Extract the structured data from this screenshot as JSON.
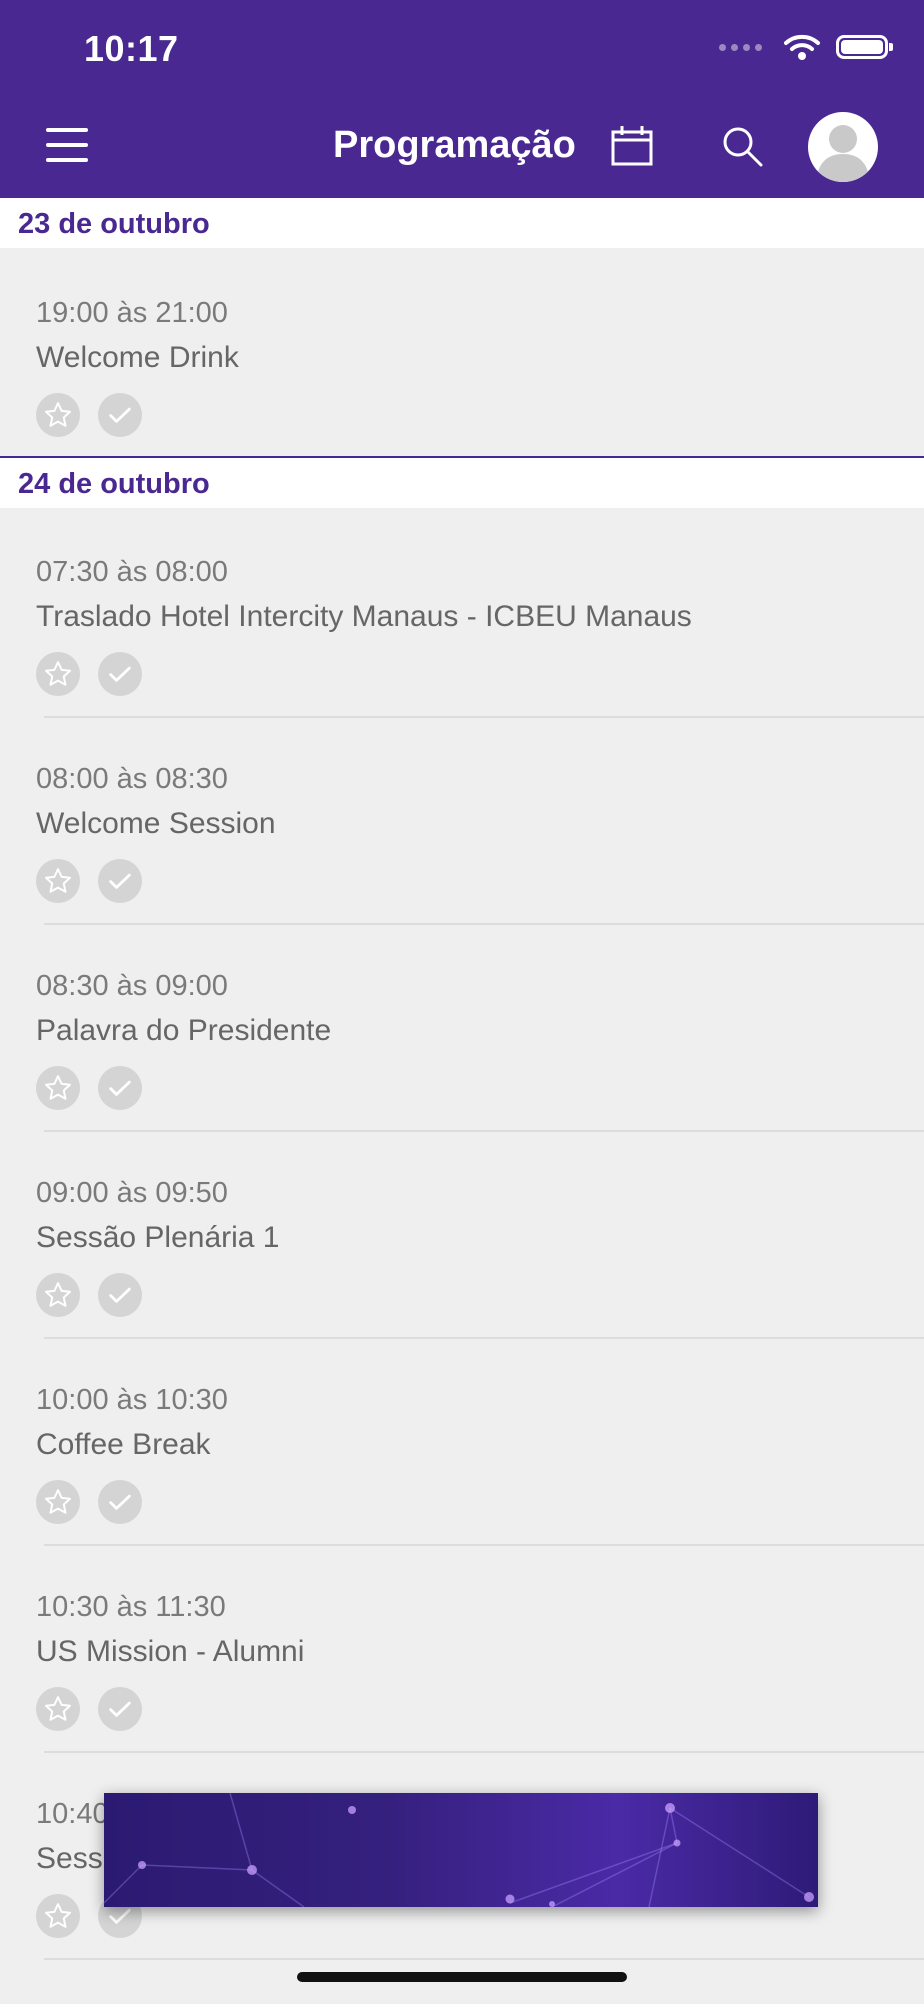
{
  "status_bar": {
    "time": "10:17"
  },
  "header": {
    "title": "Programação",
    "menu_icon": "hamburger-menu-icon",
    "calendar_icon": "calendar-icon",
    "search_icon": "search-icon",
    "avatar_icon": "user-avatar-icon",
    "background": "#4a2891"
  },
  "accent_color": "#4a2891",
  "sections": [
    {
      "date": "23 de outubro",
      "events": [
        {
          "time": "19:00 às 21:00",
          "title": "Welcome Drink"
        }
      ]
    },
    {
      "date": "24 de outubro",
      "events": [
        {
          "time": "07:30 às 08:00",
          "title": "Traslado Hotel Intercity Manaus - ICBEU Manaus"
        },
        {
          "time": "08:00 às 08:30",
          "title": "Welcome Session"
        },
        {
          "time": "08:30 às 09:00",
          "title": "Palavra do Presidente"
        },
        {
          "time": "09:00 às 09:50",
          "title": "Sessão Plenária 1"
        },
        {
          "time": "10:00 às 10:30",
          "title": "Coffee Break"
        },
        {
          "time": "10:30 às 11:30",
          "title": "US Mission - Alumni"
        },
        {
          "time": "10:40",
          "title": "Sess"
        }
      ]
    }
  ],
  "item_icons": {
    "favorite": "star-icon",
    "checkin": "check-icon"
  }
}
